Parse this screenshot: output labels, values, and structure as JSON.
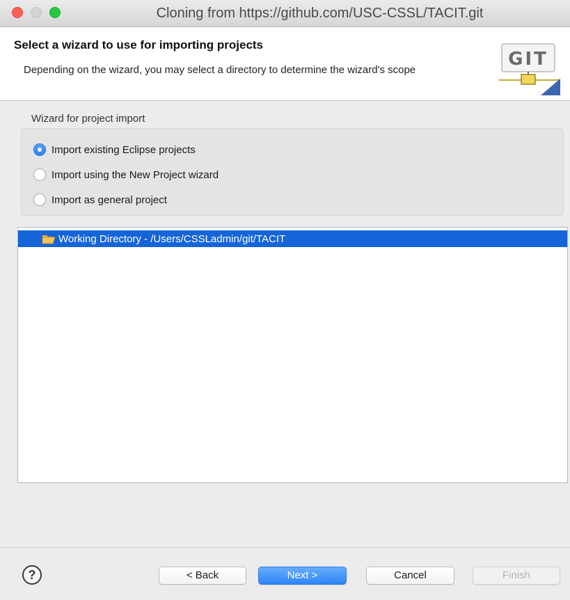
{
  "window": {
    "title": "Cloning from https://github.com/USC-CSSL/TACIT.git"
  },
  "banner": {
    "title": "Select a wizard to use for importing projects",
    "description": "Depending on the wizard, you may select a directory to determine the wizard's scope",
    "logo_text": "GIT"
  },
  "wizard_group": {
    "label": "Wizard for project import",
    "options": [
      {
        "label": "Import existing Eclipse projects",
        "selected": true
      },
      {
        "label": "Import using the New Project wizard",
        "selected": false
      },
      {
        "label": "Import as general project",
        "selected": false
      }
    ]
  },
  "tree": {
    "items": [
      {
        "label": "Working Directory - /Users/CSSLadmin/git/TACIT",
        "icon": "folder-open-icon",
        "selected": true
      }
    ]
  },
  "buttons": {
    "help": "?",
    "back": "< Back",
    "next": "Next >",
    "cancel": "Cancel",
    "finish": "Finish"
  },
  "colors": {
    "selection": "#1565d8",
    "primary_button": "#2f84f6",
    "close": "#fd5f57",
    "maximize": "#28c840"
  }
}
